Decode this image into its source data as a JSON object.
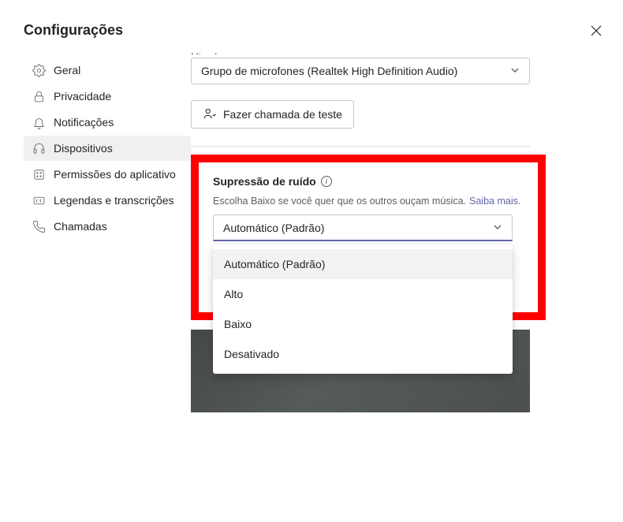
{
  "title": "Configurações",
  "sidebar": {
    "items": [
      {
        "label": "Geral",
        "icon": "gear-icon"
      },
      {
        "label": "Privacidade",
        "icon": "lock-icon"
      },
      {
        "label": "Notificações",
        "icon": "bell-icon"
      },
      {
        "label": "Dispositivos",
        "icon": "headset-icon"
      },
      {
        "label": "Permissões do aplicativo",
        "icon": "shield-icon"
      },
      {
        "label": "Legendas e transcrições",
        "icon": "cc-icon"
      },
      {
        "label": "Chamadas",
        "icon": "phone-icon"
      }
    ],
    "activeIndex": 3
  },
  "main": {
    "microphone": {
      "labelPartial": "Microfone",
      "value": "Grupo de microfones (Realtek High Definition Audio)"
    },
    "testCall": {
      "label": "Fazer chamada de teste"
    },
    "noise": {
      "title": "Supressão de ruído",
      "hint": "Escolha Baixo se você quer que os outros ouçam música.",
      "learnMore": "Saiba mais.",
      "selected": "Automático (Padrão)",
      "options": [
        "Automático (Padrão)",
        "Alto",
        "Baixo",
        "Desativado"
      ]
    }
  }
}
